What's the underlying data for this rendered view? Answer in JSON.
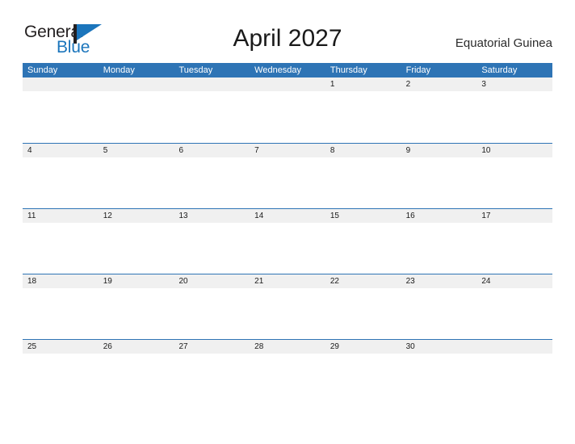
{
  "brand": {
    "name_part1": "General",
    "name_part2": "Blue",
    "flag_icon": "flag-icon"
  },
  "header": {
    "title": "April 2027",
    "location": "Equatorial Guinea"
  },
  "colors": {
    "header_blue": "#2e74b5",
    "band_gray": "#f0f0f0",
    "brand_blue": "#1b75bc",
    "text_dark": "#1a1a1a"
  },
  "calendar": {
    "month": "April",
    "year": "2027",
    "weekdays": [
      "Sunday",
      "Monday",
      "Tuesday",
      "Wednesday",
      "Thursday",
      "Friday",
      "Saturday"
    ],
    "weeks": [
      [
        "",
        "",
        "",
        "",
        "1",
        "2",
        "3"
      ],
      [
        "4",
        "5",
        "6",
        "7",
        "8",
        "9",
        "10"
      ],
      [
        "11",
        "12",
        "13",
        "14",
        "15",
        "16",
        "17"
      ],
      [
        "18",
        "19",
        "20",
        "21",
        "22",
        "23",
        "24"
      ],
      [
        "25",
        "26",
        "27",
        "28",
        "29",
        "30",
        ""
      ]
    ]
  }
}
